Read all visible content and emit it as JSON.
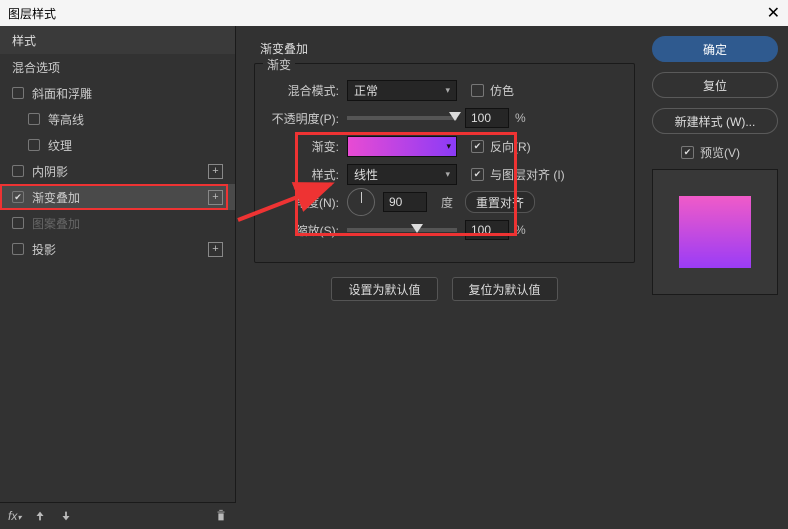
{
  "window": {
    "title": "图层样式"
  },
  "left": {
    "header": "样式",
    "blending": "混合选项",
    "bevel": "斜面和浮雕",
    "contour": "等高线",
    "texture": "纹理",
    "innerShadow": "内阴影",
    "gradientOverlay": "渐变叠加",
    "patternOverlay": "图案叠加",
    "dropShadow": "投影"
  },
  "center": {
    "sectionTitle": "渐变叠加",
    "legend": "渐变",
    "blendMode": {
      "label": "混合模式:",
      "value": "正常"
    },
    "dither": {
      "label": "仿色",
      "checked": false
    },
    "opacity": {
      "label": "不透明度(P):",
      "value": "100",
      "unit": "%"
    },
    "gradient": {
      "label": "渐变:"
    },
    "reverse": {
      "label": "反向(R)",
      "checked": true
    },
    "style": {
      "label": "样式:",
      "value": "线性"
    },
    "align": {
      "label": "与图层对齐 (I)",
      "checked": true
    },
    "angle": {
      "label": "角度(N):",
      "value": "90",
      "unit": "度"
    },
    "resetAlign": "重置对齐",
    "scale": {
      "label": "缩放(S):",
      "value": "100",
      "unit": "%"
    },
    "setDefault": "设置为默认值",
    "resetDefault": "复位为默认值"
  },
  "right": {
    "ok": "确定",
    "reset": "复位",
    "newStyle": "新建样式 (W)...",
    "previewLabel": "预览(V)"
  }
}
